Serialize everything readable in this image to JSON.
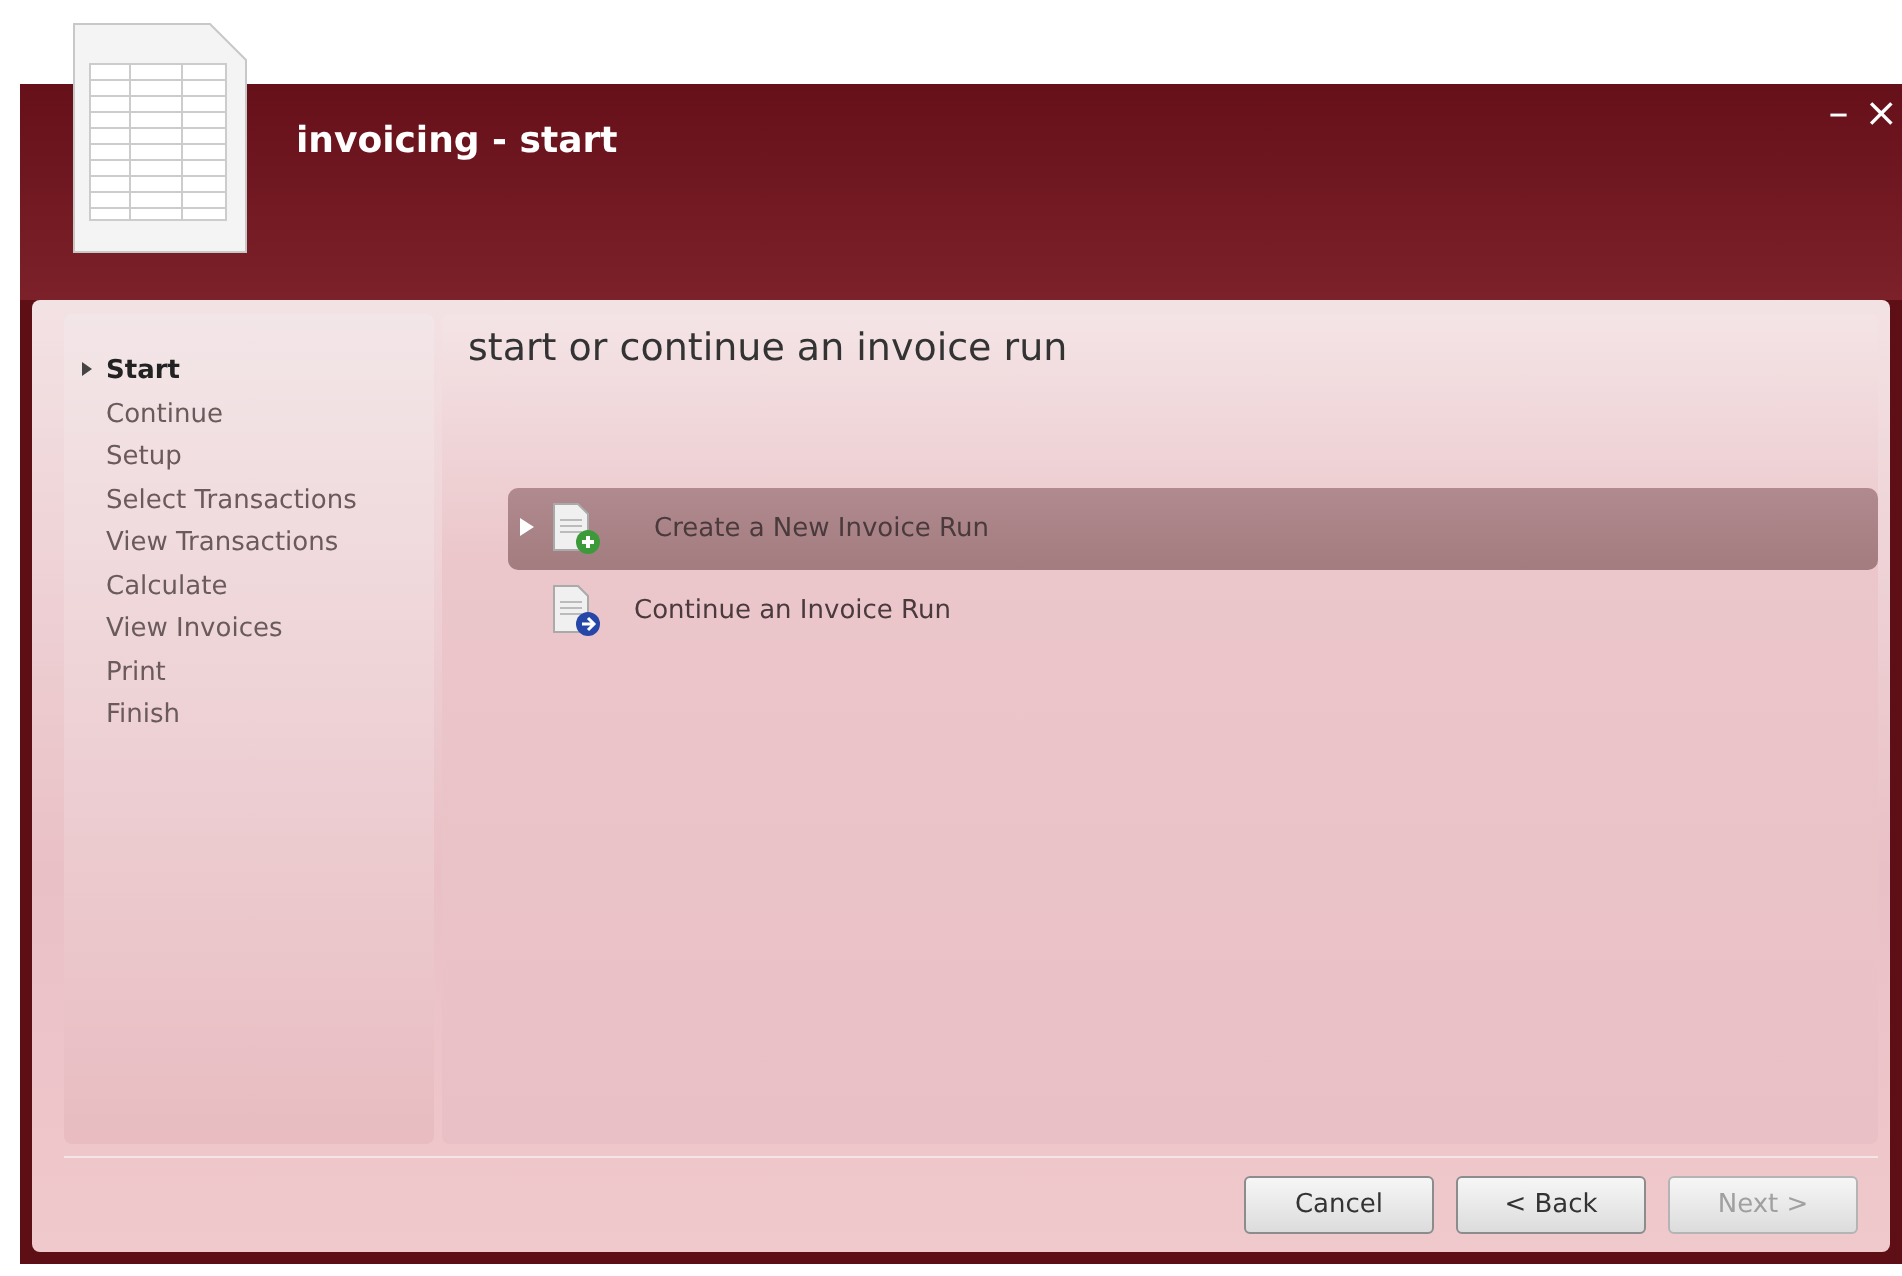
{
  "window": {
    "title": "invoicing - start",
    "controls": {
      "minimize": "–",
      "close": "×"
    }
  },
  "sidebar": {
    "items": [
      {
        "label": "Start",
        "selected": true
      },
      {
        "label": "Continue",
        "selected": false
      },
      {
        "label": "Setup",
        "selected": false
      },
      {
        "label": "Select Transactions",
        "selected": false
      },
      {
        "label": "View Transactions",
        "selected": false
      },
      {
        "label": "Calculate",
        "selected": false
      },
      {
        "label": "View Invoices",
        "selected": false
      },
      {
        "label": "Print",
        "selected": false
      },
      {
        "label": "Finish",
        "selected": false
      }
    ]
  },
  "main": {
    "heading": "start or continue an invoice run",
    "options": [
      {
        "label": "Create a New Invoice Run",
        "kind": "new",
        "selected": true
      },
      {
        "label": "Continue an Invoice Run",
        "kind": "continue",
        "selected": false
      }
    ]
  },
  "buttons": [
    {
      "label": "Cancel",
      "disabled": false
    },
    {
      "label": "< Back",
      "disabled": false
    },
    {
      "label": "Next >",
      "disabled": true
    }
  ]
}
